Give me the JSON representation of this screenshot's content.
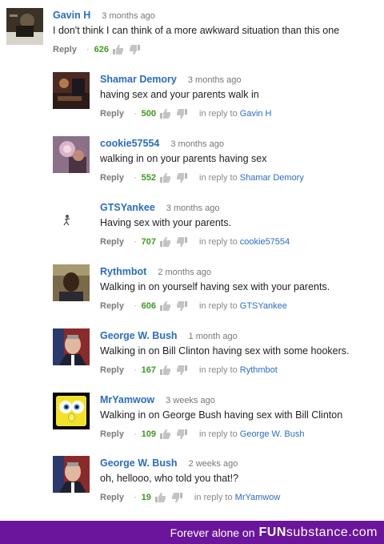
{
  "comments": [
    {
      "author": "Gavin H",
      "time": "3 months ago",
      "text": "I don't think I can think of a more awkward situation than this one",
      "reply_label": "Reply",
      "likes": "626",
      "in_reply_label": "",
      "in_reply_to": ""
    },
    {
      "author": "Shamar Demory",
      "time": "3 months ago",
      "text": "having sex and your parents walk in",
      "reply_label": "Reply",
      "likes": "500",
      "in_reply_label": "in reply to",
      "in_reply_to": "Gavin H"
    },
    {
      "author": "cookie57554",
      "time": "3 months ago",
      "text": "walking in on your parents having sex",
      "reply_label": "Reply",
      "likes": "552",
      "in_reply_label": "in reply to",
      "in_reply_to": "Shamar Demory"
    },
    {
      "author": "GTSYankee",
      "time": "3 months ago",
      "text": "Having sex with your parents.",
      "reply_label": "Reply",
      "likes": "707",
      "in_reply_label": "in reply to",
      "in_reply_to": "cookie57554"
    },
    {
      "author": "Rythmbot",
      "time": "2 months ago",
      "text": "Walking in on yourself having sex with your parents.",
      "reply_label": "Reply",
      "likes": "606",
      "in_reply_label": "in reply to",
      "in_reply_to": "GTSYankee"
    },
    {
      "author": "George W. Bush",
      "time": "1 month ago",
      "text": "Walking in on Bill Clinton having sex with some hookers.",
      "reply_label": "Reply",
      "likes": "167",
      "in_reply_label": "in reply to",
      "in_reply_to": "Rythmbot"
    },
    {
      "author": "MrYamwow",
      "time": "3 weeks ago",
      "text": "Walking in on George Bush having sex with Bill Clinton",
      "reply_label": "Reply",
      "likes": "109",
      "in_reply_label": "in reply to",
      "in_reply_to": "George W. Bush"
    },
    {
      "author": "George W. Bush",
      "time": "2 weeks ago",
      "text": "oh, hellooo, who told you that!?",
      "reply_label": "Reply",
      "likes": "19",
      "in_reply_label": "in reply to",
      "in_reply_to": "MrYamwow"
    }
  ],
  "footer": {
    "text": "Forever alone on",
    "brand_main": "FUN",
    "brand_sub": "substance",
    "brand_tld": ".com"
  },
  "colors": {
    "author": "#2a6cc1",
    "likes": "#3c9a1f",
    "footer_bg": "#6a159b"
  }
}
